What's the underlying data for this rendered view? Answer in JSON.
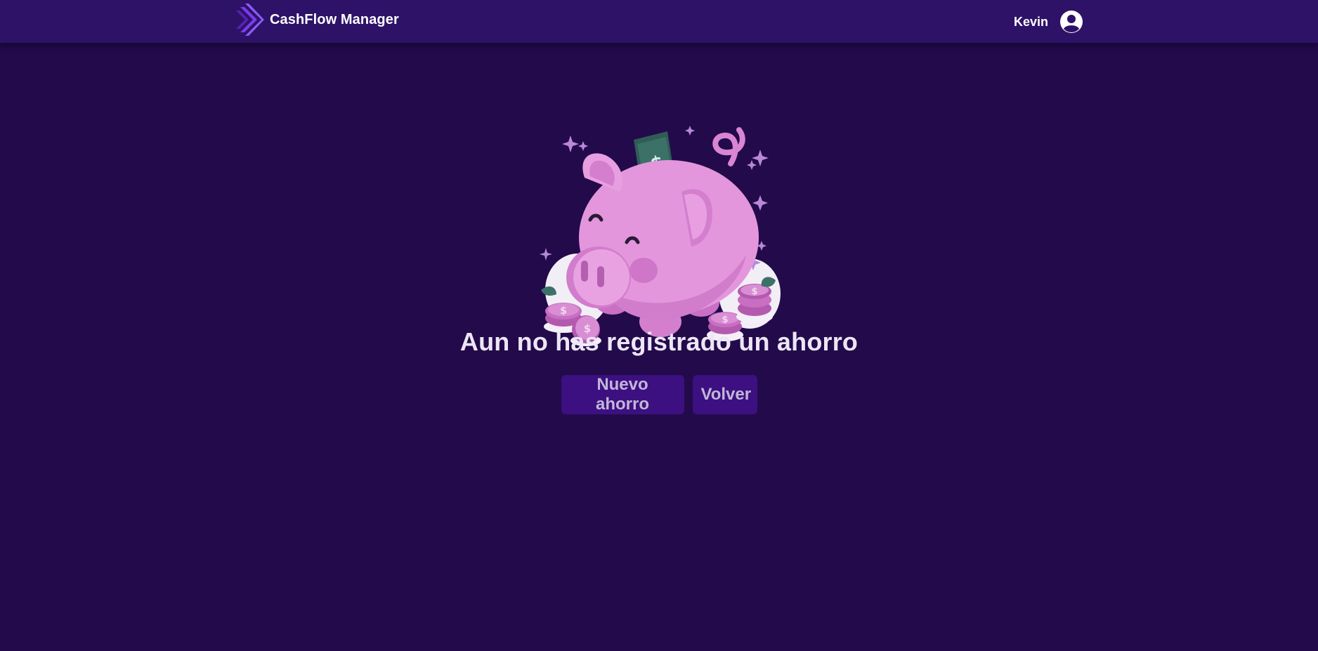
{
  "app": {
    "brand_name": "CashFlow Manager",
    "logo_icon": "chevron-stack-logo-icon",
    "colors": {
      "background": "#230a4b",
      "navbar": "#2e1268",
      "button": "#3c1080",
      "button_text": "#c2b6d8",
      "logo": "#7c3aed",
      "piggy": "#e396dc"
    }
  },
  "header": {
    "user_name": "Kevin",
    "avatar_icon": "user-circle-icon"
  },
  "empty_state": {
    "illustration": "piggy-bank-illustration",
    "title": "Aun no has registrado un ahorro",
    "buttons": {
      "new_saving": "Nuevo ahorro",
      "back": "Volver"
    }
  }
}
